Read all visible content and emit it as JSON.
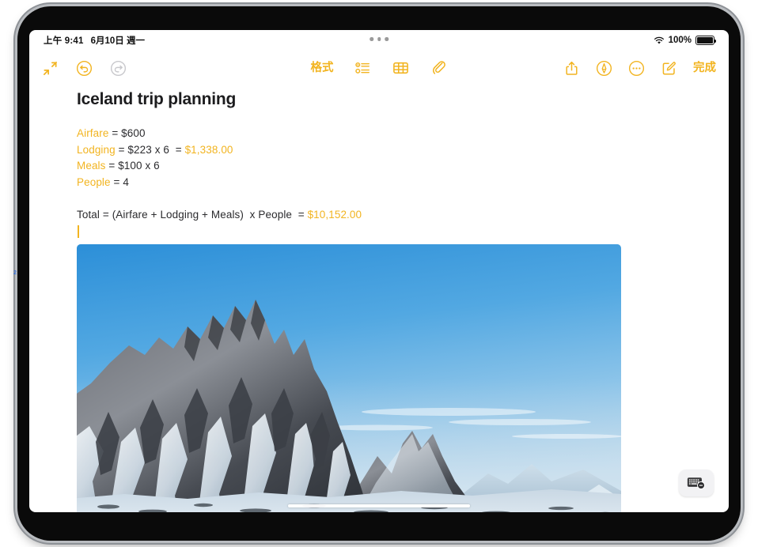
{
  "device": {
    "frame_color": "#0a0a0a",
    "edge_color": "#b9bcc0",
    "bezel_marker_label": "2"
  },
  "status_bar": {
    "time": "上午 9:41",
    "date": "6月10日 週一",
    "wifi_icon": "wifi-icon",
    "battery_percent": "100%",
    "battery_icon": "battery-icon"
  },
  "multitask": {
    "icon": "multitask-dots-icon"
  },
  "toolbar": {
    "left": [
      {
        "name": "collapse-button",
        "icon": "arrows-collapse-icon",
        "enabled": true
      },
      {
        "name": "undo-button",
        "icon": "undo-circle-icon",
        "enabled": true
      },
      {
        "name": "redo-button",
        "icon": "redo-circle-icon",
        "enabled": false
      }
    ],
    "center": [
      {
        "name": "format-button",
        "label": "格式",
        "icon": "text-format-icon"
      },
      {
        "name": "checklist-button",
        "label": "",
        "icon": "checklist-icon"
      },
      {
        "name": "table-button",
        "label": "",
        "icon": "table-icon"
      },
      {
        "name": "attachment-button",
        "label": "",
        "icon": "paperclip-icon"
      }
    ],
    "right": [
      {
        "name": "share-button",
        "label": "",
        "icon": "share-up-arrow-icon"
      },
      {
        "name": "markup-button",
        "label": "",
        "icon": "markup-pen-circle-icon"
      },
      {
        "name": "more-button",
        "label": "",
        "icon": "ellipsis-circle-icon"
      },
      {
        "name": "compose-button",
        "label": "",
        "icon": "compose-square-pencil-icon"
      },
      {
        "name": "done-button",
        "label": "完成",
        "icon": ""
      }
    ],
    "format_label": "格式",
    "done_label": "完成"
  },
  "note": {
    "title": "Iceland trip planning",
    "calc_lines": [
      {
        "var": "Airfare",
        "expr": " = $600",
        "result": ""
      },
      {
        "var": "Lodging",
        "expr": " = $223 x 6  = ",
        "result": "$1,338.00"
      },
      {
        "var": "Meals",
        "expr": " = $100 x 6",
        "result": ""
      },
      {
        "var": "People",
        "expr": " = 4",
        "result": ""
      }
    ],
    "total_line": {
      "text": "Total = (Airfare + Lodging + Meals)  x People  = ",
      "result": "$10,152.00"
    },
    "accent_color": "#F2B420",
    "text_color": "#2b2b2e",
    "photo_alt": "Snow covered mountain ridge under clear blue sky in Iceland"
  },
  "keyboard": {
    "dismiss_button_name": "keyboard-dismiss-button",
    "dismiss_icon": "keyboard-hide-icon"
  },
  "home_indicator": {
    "name": "home-indicator"
  }
}
